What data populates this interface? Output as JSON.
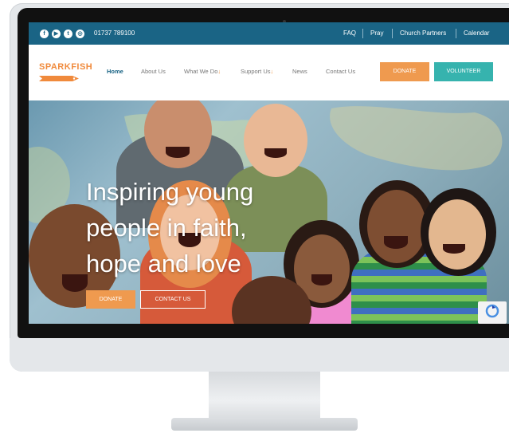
{
  "topbar": {
    "phone": "01737 789100",
    "links": [
      "FAQ",
      "Pray",
      "Church Partners",
      "Calendar"
    ],
    "social_icons": [
      "facebook-icon",
      "youtube-icon",
      "twitter-icon",
      "instagram-icon"
    ]
  },
  "nav": {
    "logo": "SPARKFISH",
    "links": [
      "Home",
      "About Us",
      "What We Do",
      "Support Us",
      "News",
      "Contact Us"
    ],
    "dropdown_indicator": "↓",
    "donate": "DONATE",
    "volunteer": "VOLUNTEER"
  },
  "hero": {
    "headline_lines": [
      "Inspiring young",
      "people in faith,",
      "hope and love"
    ],
    "donate": "DONATE",
    "contact": "CONTACT US"
  },
  "colors": {
    "topbar": "#1a6485",
    "orange": "#ef9a4f",
    "teal": "#36b3ae"
  }
}
